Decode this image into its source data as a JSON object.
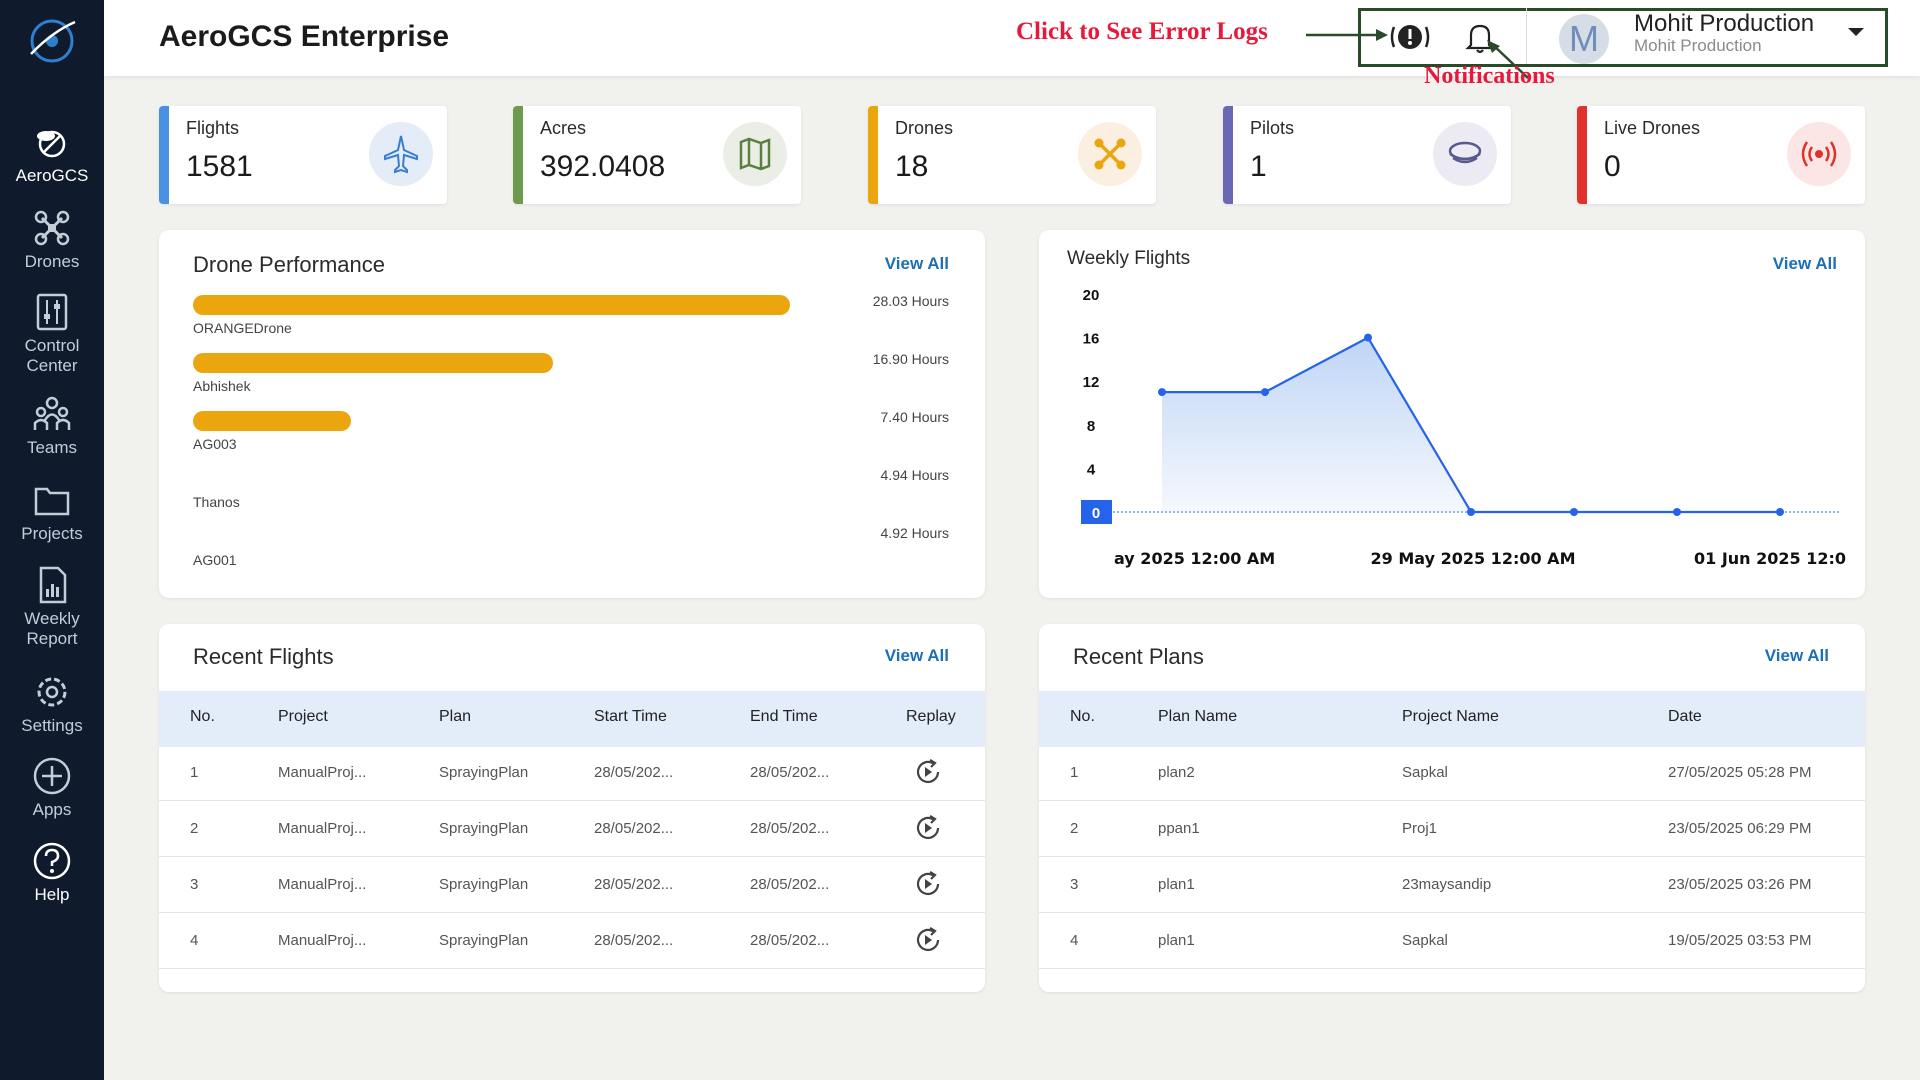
{
  "header": {
    "title": "AeroGCS Enterprise",
    "annotation_errors": "Click to  See Error Logs",
    "annotation_notifications": "Notifications",
    "user": {
      "initial": "M",
      "name": "Mohit Production",
      "subtitle": "Mohit Production"
    }
  },
  "sidebar": {
    "items": [
      {
        "label": "AeroGCS",
        "icon": "drone-propeller-icon"
      },
      {
        "label": "Drones",
        "icon": "quadcopter-icon"
      },
      {
        "label": "Control Center",
        "icon": "sliders-icon"
      },
      {
        "label": "Teams",
        "icon": "team-icon"
      },
      {
        "label": "Projects",
        "icon": "folder-icon"
      },
      {
        "label": "Weekly Report",
        "icon": "report-icon"
      },
      {
        "label": "Settings",
        "icon": "gear-icon"
      },
      {
        "label": "Apps",
        "icon": "plus-circle-icon"
      },
      {
        "label": "Help",
        "icon": "help-icon"
      }
    ]
  },
  "stats": [
    {
      "label": "Flights",
      "value": "1581",
      "color": "#4a90e2",
      "icon": "airplane-icon"
    },
    {
      "label": "Acres",
      "value": "392.0408",
      "color": "#6e9a4e",
      "icon": "map-icon"
    },
    {
      "label": "Drones",
      "value": "18",
      "color": "#eba60d",
      "icon": "quadcopter-icon"
    },
    {
      "label": "Pilots",
      "value": "1",
      "color": "#6b68b3",
      "icon": "pilot-hat-icon"
    },
    {
      "label": "Live Drones",
      "value": "0",
      "color": "#e0322b",
      "icon": "broadcast-icon"
    }
  ],
  "drone_performance": {
    "title": "Drone Performance",
    "view_all": "View All",
    "items": [
      {
        "name": "ORANGEDrone",
        "hours_label": "28.03 Hours",
        "hours": 28.03
      },
      {
        "name": "Abhishek",
        "hours_label": "16.90 Hours",
        "hours": 16.9
      },
      {
        "name": "AG003",
        "hours_label": "7.40 Hours",
        "hours": 7.4
      },
      {
        "name": "Thanos",
        "hours_label": "4.94 Hours",
        "hours": 4.94
      },
      {
        "name": "AG001",
        "hours_label": "4.92 Hours",
        "hours": 4.92
      }
    ]
  },
  "weekly_flights": {
    "title": "Weekly Flights",
    "view_all": "View All"
  },
  "chart_data": {
    "type": "area",
    "title": "Weekly Flights",
    "y_ticks": [
      0,
      4,
      8,
      12,
      16,
      20
    ],
    "ylim": [
      0,
      20
    ],
    "x_tick_labels": [
      "ay 2025 12:00 AM",
      "29 May 2025 12:00 AM",
      "01 Jun 2025 12:0"
    ],
    "values": [
      11,
      11,
      16,
      0,
      0,
      0,
      0
    ],
    "color": "#2563eb",
    "fill": "#bcd3f5"
  },
  "recent_flights": {
    "title": "Recent Flights",
    "view_all": "View All",
    "columns": [
      "No.",
      "Project",
      "Plan",
      "Start Time",
      "End Time",
      "Replay"
    ],
    "rows": [
      {
        "no": "1",
        "project": "ManualProj...",
        "plan": "SprayingPlan",
        "start": "28/05/202...",
        "end": "28/05/202..."
      },
      {
        "no": "2",
        "project": "ManualProj...",
        "plan": "SprayingPlan",
        "start": "28/05/202...",
        "end": "28/05/202..."
      },
      {
        "no": "3",
        "project": "ManualProj...",
        "plan": "SprayingPlan",
        "start": "28/05/202...",
        "end": "28/05/202..."
      },
      {
        "no": "4",
        "project": "ManualProj...",
        "plan": "SprayingPlan",
        "start": "28/05/202...",
        "end": "28/05/202..."
      }
    ]
  },
  "recent_plans": {
    "title": "Recent Plans",
    "view_all": "View All",
    "columns": [
      "No.",
      "Plan Name",
      "Project Name",
      "Date"
    ],
    "rows": [
      {
        "no": "1",
        "plan": "plan2",
        "project": "Sapkal",
        "date": "27/05/2025 05:28 PM"
      },
      {
        "no": "2",
        "plan": "ppan1",
        "project": "Proj1",
        "date": "23/05/2025 06:29 PM"
      },
      {
        "no": "3",
        "plan": "plan1",
        "project": "23maysandip",
        "date": "23/05/2025 03:26 PM"
      },
      {
        "no": "4",
        "plan": "plan1",
        "project": "Sapkal",
        "date": "19/05/2025 03:53 PM"
      }
    ]
  }
}
